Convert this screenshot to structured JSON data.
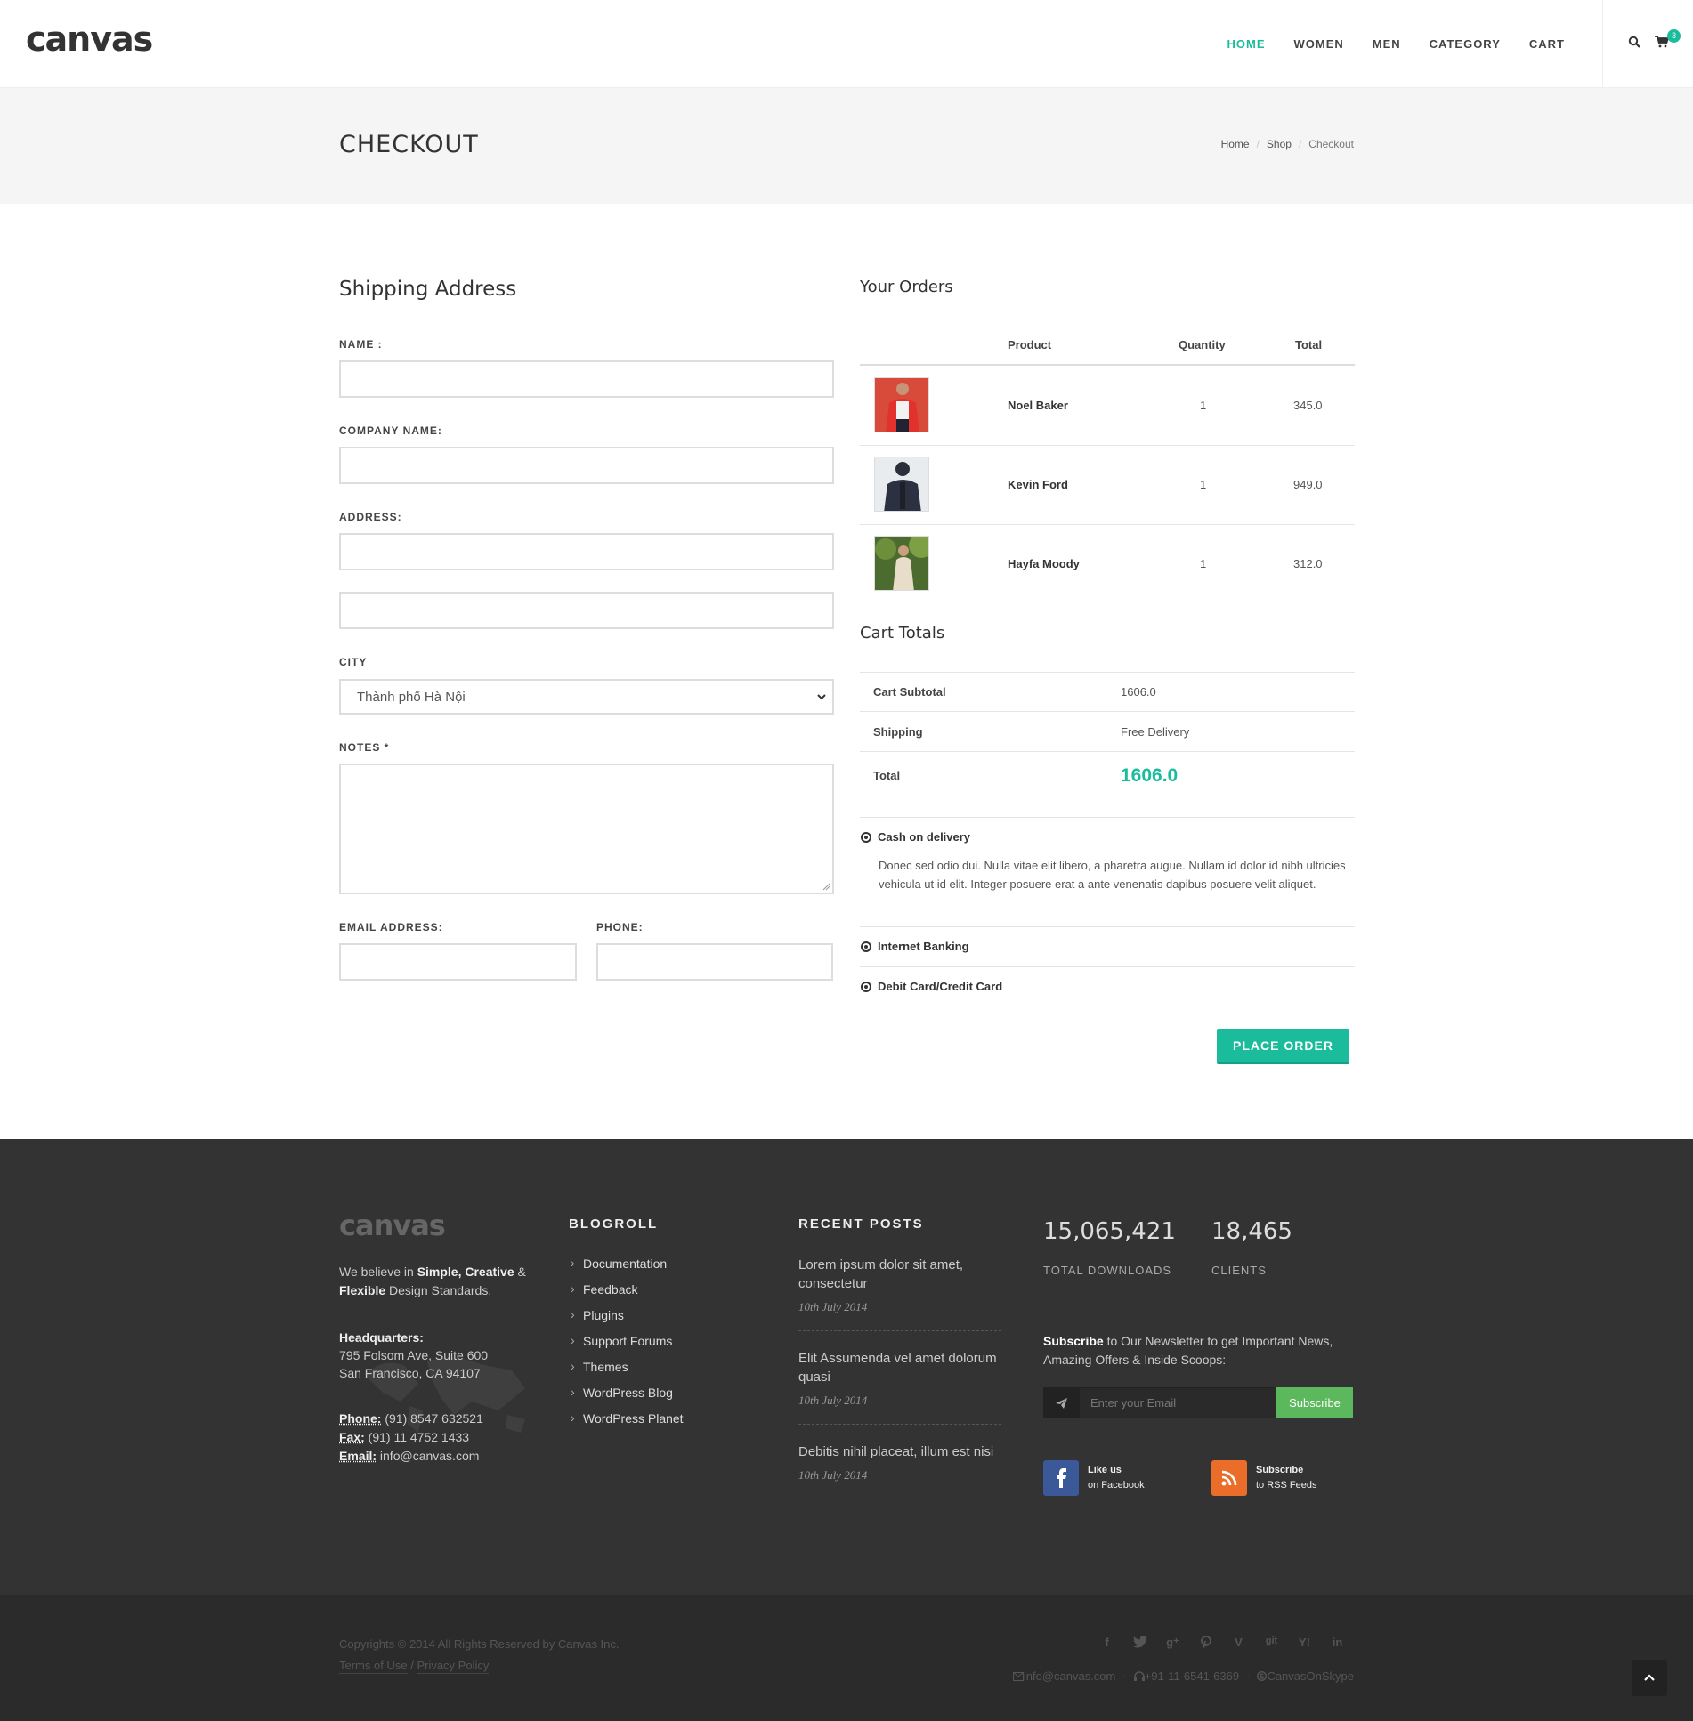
{
  "brand": {
    "logo": "canvas"
  },
  "nav": {
    "items": [
      "HOME",
      "WOMEN",
      "MEN",
      "CATEGORY",
      "CART"
    ],
    "active_index": 0,
    "cart_count": "3"
  },
  "page_title": {
    "title": "CHECKOUT",
    "breadcrumb": [
      "Home",
      "Shop",
      "Checkout"
    ]
  },
  "shipping": {
    "heading": "Shipping Address",
    "name_label": "NAME :",
    "company_label": "COMPANY NAME:",
    "address_label": "ADDRESS:",
    "city_label": "CITY",
    "city_value": "Thành phố Hà Nội",
    "notes_label": "NOTES *",
    "email_label": "EMAIL ADDRESS:",
    "phone_label": "PHONE:"
  },
  "orders": {
    "heading": "Your Orders",
    "columns": [
      "Product",
      "Quantity",
      "Total"
    ],
    "rows": [
      {
        "name": "Noel Baker",
        "qty": "1",
        "total": "345.0"
      },
      {
        "name": "Kevin Ford",
        "qty": "1",
        "total": "949.0"
      },
      {
        "name": "Hayfa Moody",
        "qty": "1",
        "total": "312.0"
      }
    ]
  },
  "cart_totals": {
    "heading": "Cart Totals",
    "subtotal_label": "Cart Subtotal",
    "subtotal_value": "1606.0",
    "shipping_label": "Shipping",
    "shipping_value": "Free Delivery",
    "total_label": "Total",
    "total_value": "1606.0"
  },
  "payment": {
    "options": [
      "Cash on delivery",
      "Internet Banking",
      "Debit Card/Credit Card"
    ],
    "description": "Donec sed odio dui. Nulla vitae elit libero, a pharetra augue. Nullam id dolor id nibh ultricies vehicula ut id elit. Integer posuere erat a ante venenatis dapibus posuere velit aliquet.",
    "place_order": "PLACE ORDER"
  },
  "footer": {
    "logo": "canvas",
    "tagline_1": "We believe in ",
    "tagline_bold_1": "Simple, Creative",
    "tagline_2": " & ",
    "tagline_bold_2": "Flexible",
    "tagline_3": " Design Standards.",
    "hq_label": "Headquarters:",
    "hq_line1": "795 Folsom Ave, Suite 600",
    "hq_line2": "San Francisco, CA 94107",
    "phone_label": "Phone:",
    "phone_value": " (91) 8547 632521",
    "fax_label": "Fax:",
    "fax_value": " (91) 11 4752 1433",
    "email_label": "Email:",
    "email_value": " info@canvas.com",
    "blogroll_heading": "BLOGROLL",
    "blogroll": [
      "Documentation",
      "Feedback",
      "Plugins",
      "Support Forums",
      "Themes",
      "WordPress Blog",
      "WordPress Planet"
    ],
    "recent_heading": "RECENT POSTS",
    "posts": [
      {
        "title": "Lorem ipsum dolor sit amet, consectetur",
        "date": "10th July 2014"
      },
      {
        "title": "Elit Assumenda vel amet dolorum quasi",
        "date": "10th July 2014"
      },
      {
        "title": "Debitis nihil placeat, illum est nisi",
        "date": "10th July 2014"
      }
    ],
    "downloads_value": "15,065,421",
    "downloads_label": "TOTAL DOWNLOADS",
    "clients_value": "18,465",
    "clients_label": "CLIENTS",
    "newsletter_bold": "Subscribe",
    "newsletter_text": " to Our Newsletter to get Important News, Amazing Offers & Inside Scoops:",
    "email_placeholder": "Enter your Email",
    "subscribe_button": "Subscribe",
    "facebook_line1": "Like us",
    "facebook_line2": "on Facebook",
    "rss_line1": "Subscribe",
    "rss_line2": "to RSS Feeds"
  },
  "copyrights": {
    "text": "Copyrights © 2014 All Rights Reserved by Canvas Inc.",
    "terms": "Terms of Use",
    "privacy": "Privacy Policy",
    "contact_email": "info@canvas.com",
    "contact_phone": "+91-11-6541-6369",
    "contact_skype": "CanvasOnSkype"
  },
  "colors": {
    "accent": "#1abc9c",
    "footer_bg": "#333333",
    "copyrights_bg": "#2b2b2b",
    "subscribe_green": "#5cb85c",
    "facebook_blue": "#3b5998",
    "rss_orange": "#ea6d29"
  },
  "icons": [
    "search-icon",
    "cart-icon",
    "chevron-down-icon",
    "radio-checked-icon",
    "paper-plane-icon",
    "facebook-icon",
    "rss-icon",
    "twitter-icon",
    "google-plus-icon",
    "pinterest-icon",
    "vimeo-icon",
    "github-icon",
    "yahoo-icon",
    "linkedin-icon",
    "envelope-icon",
    "headphones-icon",
    "skype-icon",
    "chevron-up-icon"
  ]
}
